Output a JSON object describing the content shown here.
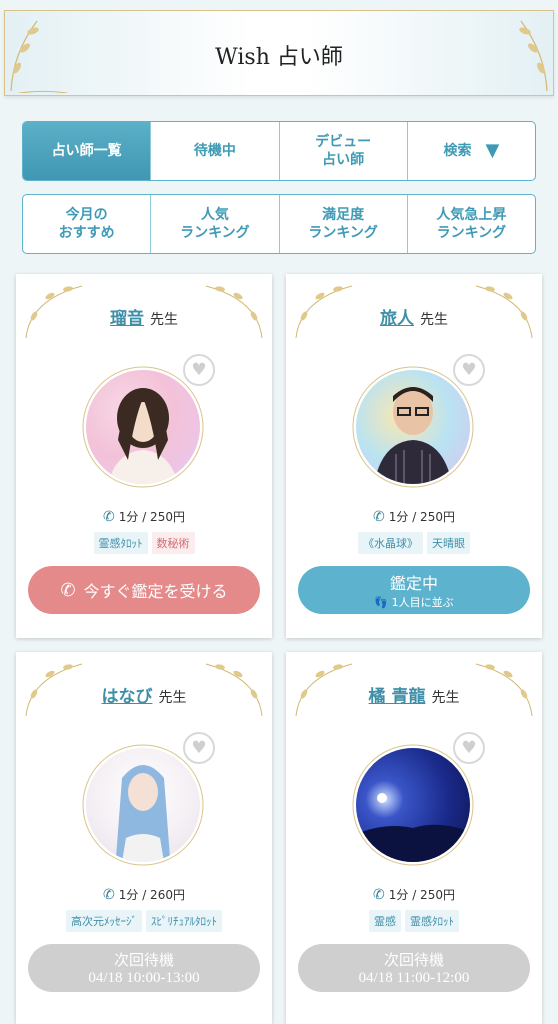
{
  "header": {
    "title": "Wish 占い師"
  },
  "tabs": [
    {
      "label": "占い師一覧"
    },
    {
      "label": "待機中"
    },
    {
      "label": "デビュー\n占い師"
    },
    {
      "label": "検索"
    }
  ],
  "tab_arrow": "▼",
  "rankings": [
    {
      "label": "今月の\nおすすめ"
    },
    {
      "label": "人気\nランキング"
    },
    {
      "label": "満足度\nランキング"
    },
    {
      "label": "人気急上昇\nランキング"
    }
  ],
  "sensei_label": "先生",
  "cards": [
    {
      "name": "瑠音",
      "price": "1分 / 250円",
      "tags": [
        {
          "label": "霊感ﾀﾛｯﾄ",
          "color": "blue"
        },
        {
          "label": "数秘術",
          "color": "pink"
        }
      ],
      "button": {
        "main": "今すぐ鑑定を受ける",
        "sub": ""
      },
      "status": "available"
    },
    {
      "name": "旅人",
      "price": "1分 / 250円",
      "tags": [
        {
          "label": "《水晶球》",
          "color": "blue"
        },
        {
          "label": "天晴眼",
          "color": "blue"
        }
      ],
      "button": {
        "main": "鑑定中",
        "sub": "1人目に並ぶ"
      },
      "status": "busy"
    },
    {
      "name": "はなび",
      "price": "1分 / 260円",
      "tags": [
        {
          "label": "高次元ﾒｯｾｰｼﾞ",
          "color": "blue"
        },
        {
          "label": "ｽﾋﾟﾘﾁｭｱﾙﾀﾛｯﾄ",
          "color": "blue"
        }
      ],
      "button": {
        "main": "次回待機",
        "sub": "04/18 10:00-13:00"
      },
      "status": "offline"
    },
    {
      "name": "橘 青龍",
      "price": "1分 / 250円",
      "tags": [
        {
          "label": "霊感",
          "color": "blue"
        },
        {
          "label": "霊感ﾀﾛｯﾄ",
          "color": "blue"
        }
      ],
      "button": {
        "main": "次回待機",
        "sub": "04/18 11:00-12:00"
      },
      "status": "offline"
    }
  ],
  "colors": {
    "accent": "#3f9bb5",
    "pink_button": "#e58a8a",
    "blue_button": "#5db3cd",
    "gray_button": "#cfcfcf",
    "gold": "#d9c38a"
  }
}
